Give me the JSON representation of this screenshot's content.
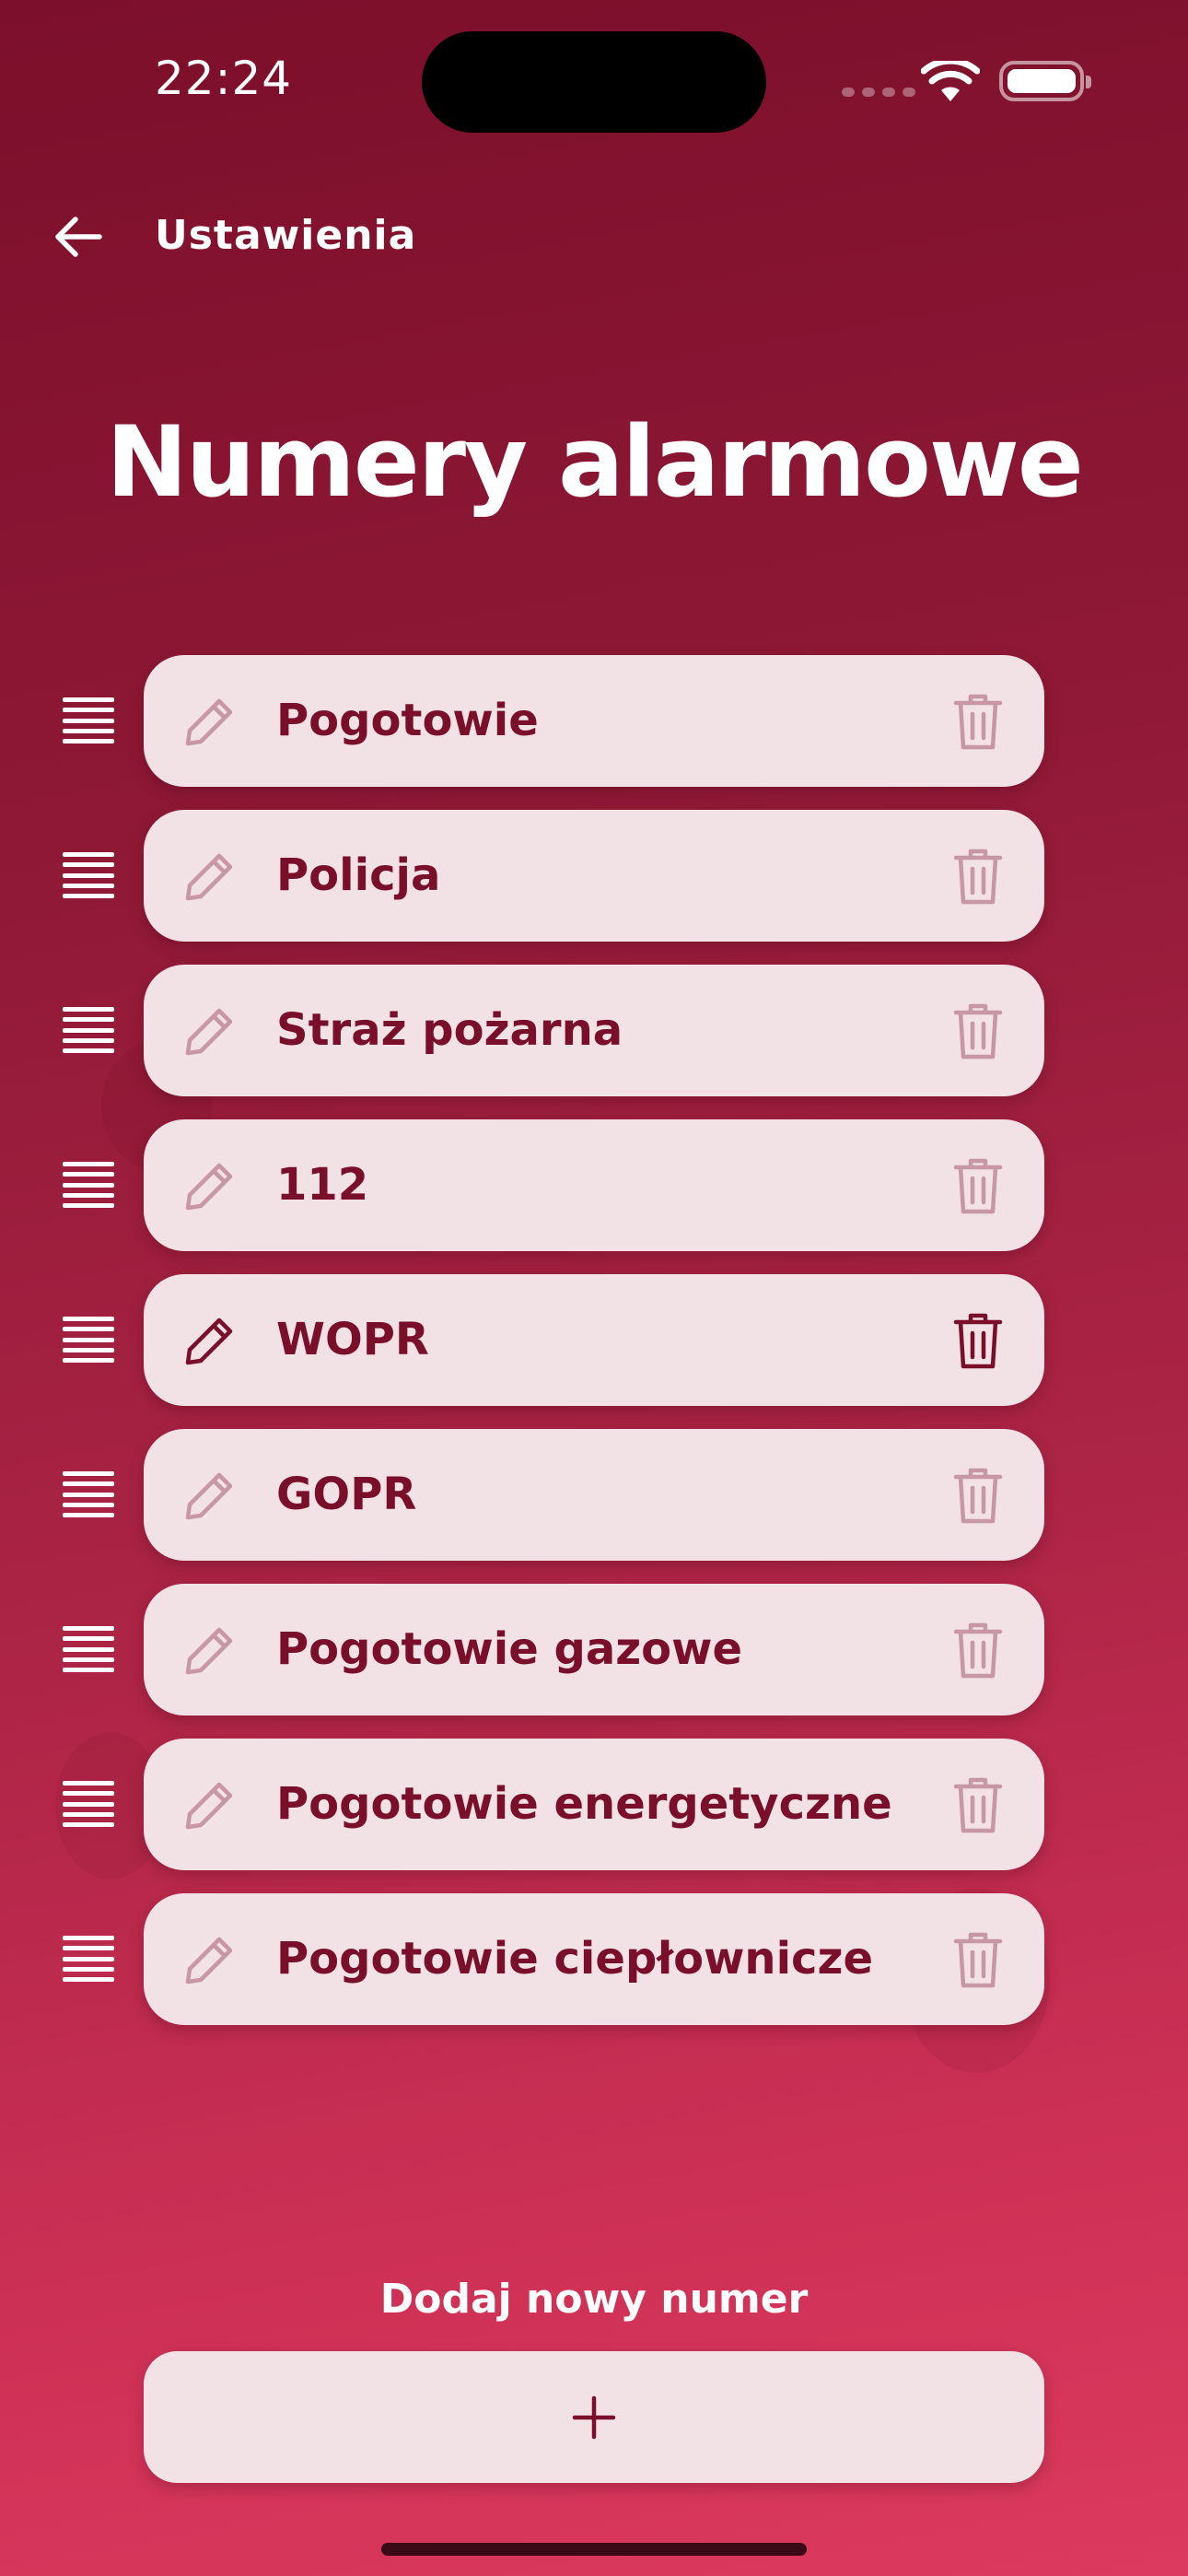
{
  "status_bar": {
    "time": "22:24"
  },
  "header": {
    "back_icon": "arrow-left-icon",
    "title": "Ustawienia"
  },
  "page": {
    "title": "Numery alarmowe"
  },
  "items": [
    {
      "label": "Pogotowie",
      "active": false
    },
    {
      "label": "Policja",
      "active": false
    },
    {
      "label": "Straż pożarna",
      "active": false
    },
    {
      "label": "112",
      "active": false
    },
    {
      "label": "WOPR",
      "active": true
    },
    {
      "label": "GOPR",
      "active": false
    },
    {
      "label": "Pogotowie gazowe",
      "active": false
    },
    {
      "label": "Pogotowie energetyczne",
      "active": false
    },
    {
      "label": "Pogotowie ciepłownicze",
      "active": false
    }
  ],
  "add_section": {
    "label": "Dodaj nowy numer",
    "button_icon": "plus-icon"
  },
  "colors": {
    "accent": "#7a0f2b",
    "card": "#f2e1e5",
    "background_top": "#7c0f2b",
    "background_bottom": "#dc3a5e"
  }
}
